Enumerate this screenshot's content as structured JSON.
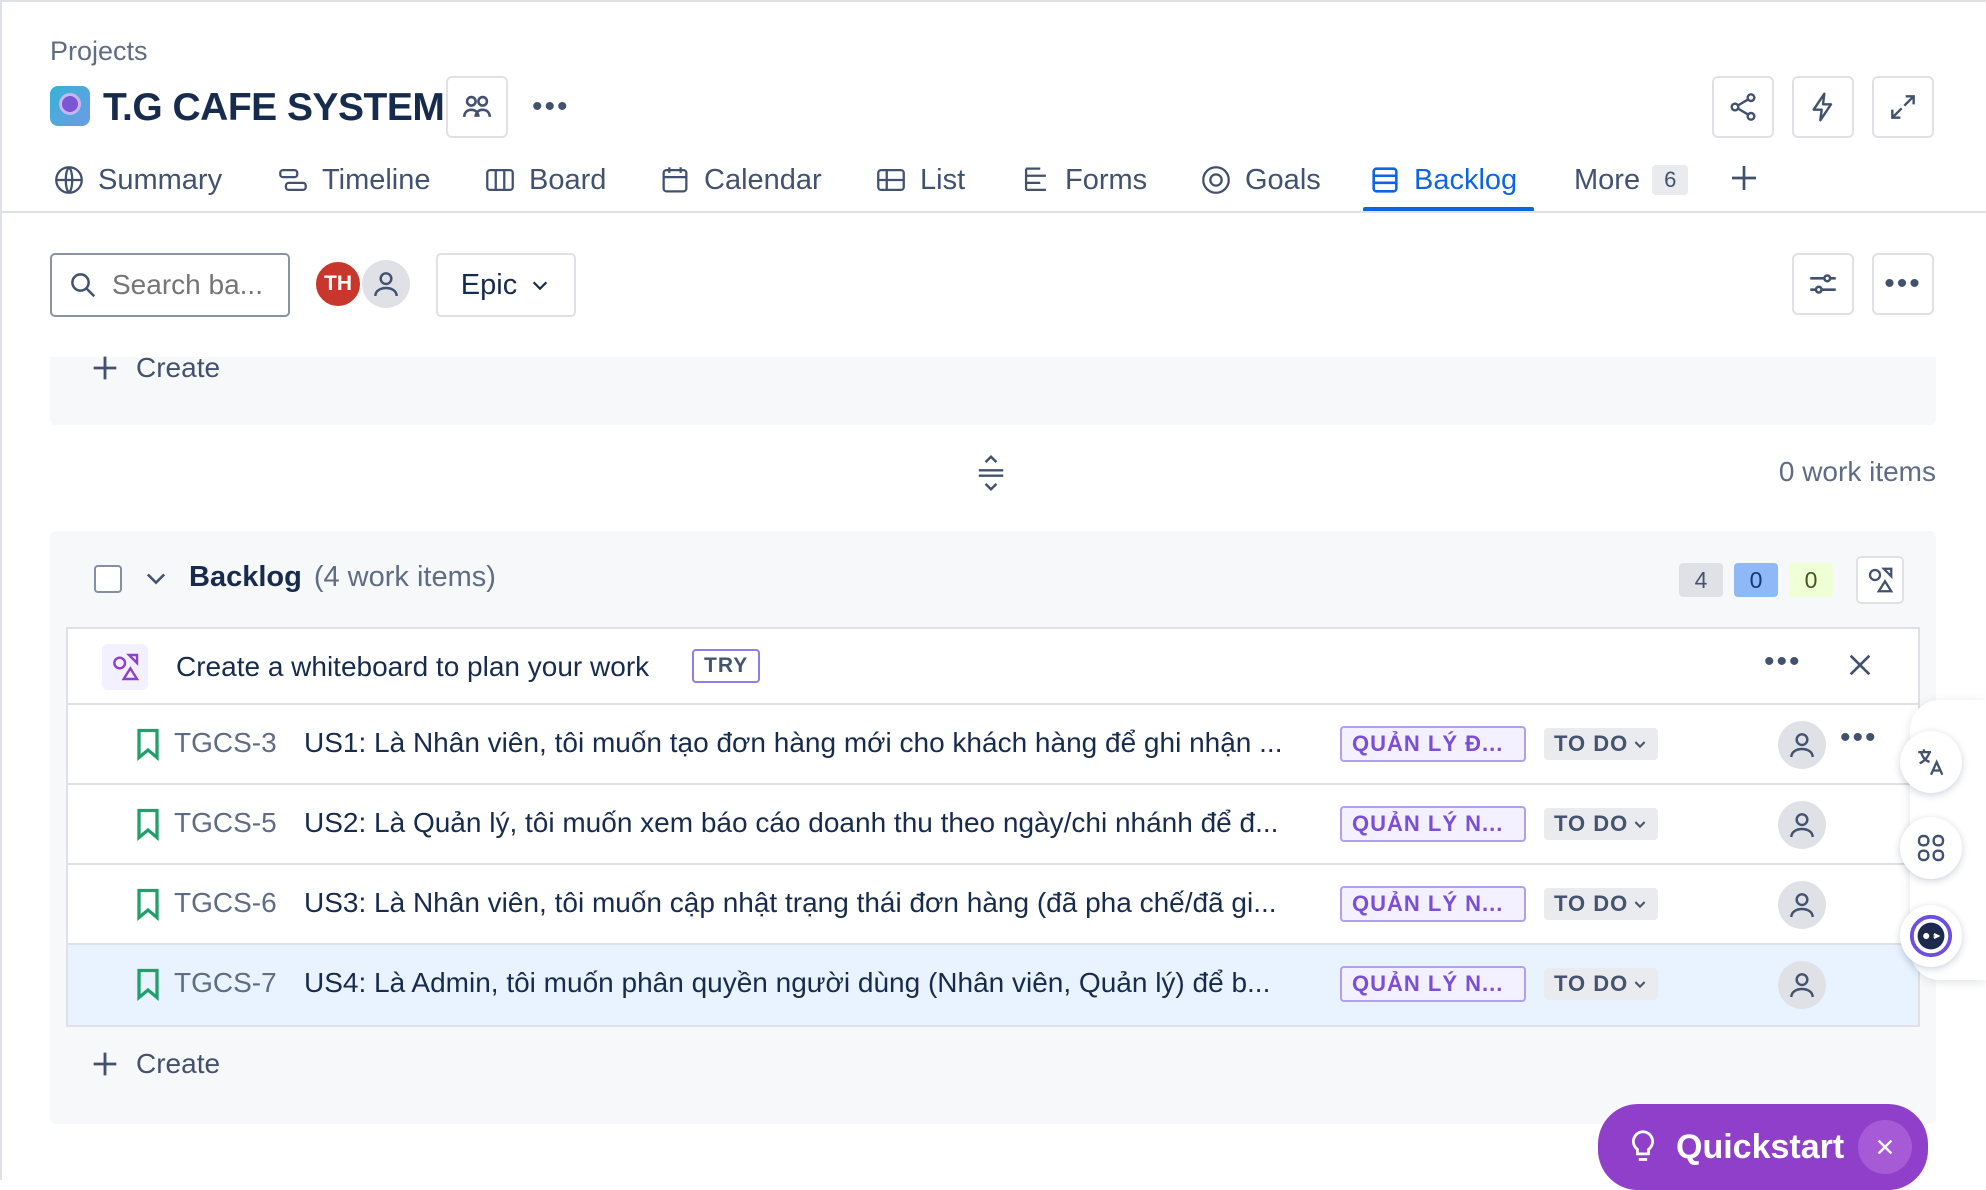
{
  "header": {
    "breadcrumb": "Projects",
    "project_title": "T.G CAFE SYSTEM"
  },
  "tabs": [
    {
      "label": "Summary",
      "icon": "globe-icon"
    },
    {
      "label": "Timeline",
      "icon": "timeline-icon"
    },
    {
      "label": "Board",
      "icon": "board-icon"
    },
    {
      "label": "Calendar",
      "icon": "calendar-icon"
    },
    {
      "label": "List",
      "icon": "list-icon"
    },
    {
      "label": "Forms",
      "icon": "forms-icon"
    },
    {
      "label": "Goals",
      "icon": "goals-icon"
    },
    {
      "label": "Backlog",
      "icon": "backlog-icon",
      "active": true
    },
    {
      "label": "More",
      "icon": "none"
    }
  ],
  "more_count": "6",
  "toolbar": {
    "search_placeholder": "Search ba...",
    "avatar_initials": "TH",
    "epic_label": "Epic"
  },
  "sprint": {
    "create_label": "Create",
    "work_items": "0 work items"
  },
  "backlog": {
    "title": "Backlog",
    "subtitle": "(4 work items)",
    "counts": {
      "todo": "4",
      "in_progress": "0",
      "done": "0"
    },
    "whiteboard_prompt": "Create a whiteboard to plan your work",
    "try_label": "TRY",
    "create_label": "Create",
    "items": [
      {
        "key": "TGCS-3",
        "summary": "US1: Là Nhân viên, tôi muốn tạo đơn hàng mới cho khách hàng để ghi nhận ...",
        "epic": "QUẢN LÝ Đ...",
        "status": "TO DO"
      },
      {
        "key": "TGCS-5",
        "summary": "US2: Là Quản lý, tôi muốn xem báo cáo doanh thu theo ngày/chi nhánh để đ...",
        "epic": "QUẢN LÝ N...",
        "status": "TO DO"
      },
      {
        "key": "TGCS-6",
        "summary": "US3: Là Nhân viên, tôi muốn cập nhật trạng thái đơn hàng (đã pha chế/đã gi...",
        "epic": "QUẢN LÝ N...",
        "status": "TO DO"
      },
      {
        "key": "TGCS-7",
        "summary": "US4: Là Admin, tôi muốn phân quyền người dùng (Nhân viên, Quản lý) để b...",
        "epic": "QUẢN LÝ N...",
        "status": "TO DO"
      }
    ]
  },
  "quickstart_label": "Quickstart",
  "colors": {
    "accent": "#0c66e4",
    "epic_purple": "#7a4fd6",
    "quickstart": "#8f3fc9",
    "story_green": "#22a06b",
    "avatar_red": "#c9372c"
  }
}
